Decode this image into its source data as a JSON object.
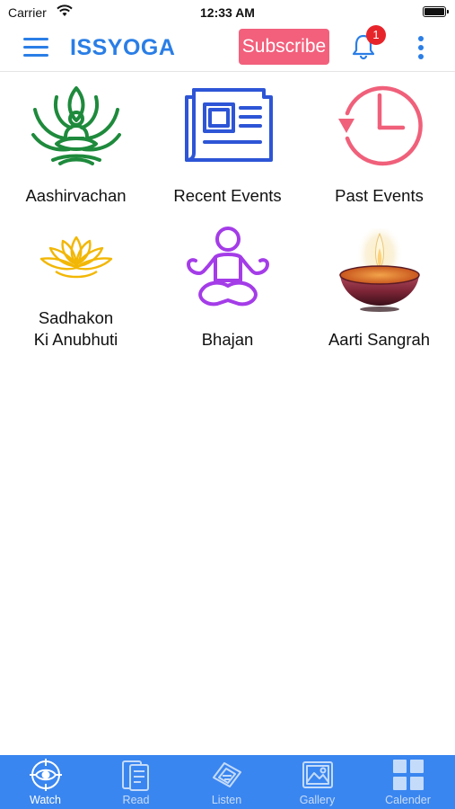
{
  "status_bar": {
    "carrier": "Carrier",
    "time": "12:33 AM"
  },
  "header": {
    "title": "ISSYOGA",
    "subscribe_label": "Subscribe",
    "notification_count": "1"
  },
  "grid": {
    "items": [
      {
        "label": "Aashirvachan",
        "icon": "meditating-guru-lotus-icon"
      },
      {
        "label": "Recent Events",
        "icon": "newspaper-icon"
      },
      {
        "label": "Past Events",
        "icon": "history-clock-icon"
      },
      {
        "label_line1": "Sadhakon",
        "label_line2": "Ki Anubhuti",
        "icon": "golden-lotus-icon"
      },
      {
        "label": "Bhajan",
        "icon": "yoga-pose-icon"
      },
      {
        "label": "Aarti Sangrah",
        "icon": "diya-lamp-icon"
      }
    ]
  },
  "tabs": [
    {
      "label": "Watch",
      "icon": "target-eye-icon",
      "active": true
    },
    {
      "label": "Read",
      "icon": "book-icon",
      "active": false
    },
    {
      "label": "Listen",
      "icon": "radio-waves-icon",
      "active": false
    },
    {
      "label": "Gallery",
      "icon": "image-gallery-icon",
      "active": false
    },
    {
      "label": "Calender",
      "icon": "grid-calendar-icon",
      "active": false
    }
  ],
  "colors": {
    "accent": "#2a7ee6",
    "subscribe": "#f2607c",
    "badge": "#e8242b",
    "tab_bar": "#3a86f0",
    "guru_green": "#1e8a3c",
    "news_blue": "#2d55d6",
    "clock_pink": "#f0607a",
    "lotus_gold": "#f2b705",
    "yoga_purple": "#a43ce8"
  }
}
